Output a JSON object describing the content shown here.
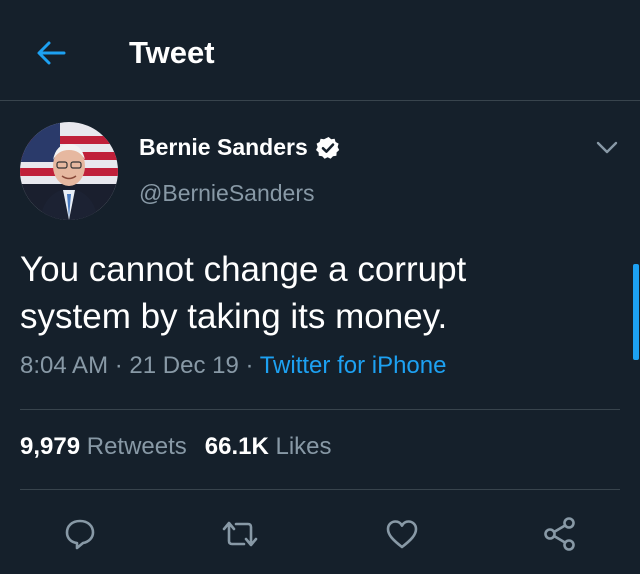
{
  "header": {
    "title": "Tweet"
  },
  "author": {
    "name": "Bernie Sanders",
    "handle": "@BernieSanders"
  },
  "tweet": {
    "text": "You cannot change a corrupt system by taking its money.",
    "time": "8:04 AM",
    "date": "21 Dec 19",
    "source": "Twitter for iPhone"
  },
  "stats": {
    "retweets_count": "9,979",
    "retweets_label": "Retweets",
    "likes_count": "66.1K",
    "likes_label": "Likes"
  },
  "icons": {
    "back": "arrow-left-icon",
    "verified": "verified-badge-icon",
    "menu": "chevron-down-icon",
    "reply": "reply-icon",
    "retweet": "retweet-icon",
    "like": "heart-icon",
    "share": "share-icon"
  },
  "colors": {
    "background": "#15202b",
    "accent": "#1da1f2",
    "muted": "#8899a6",
    "divider": "#38444d"
  }
}
